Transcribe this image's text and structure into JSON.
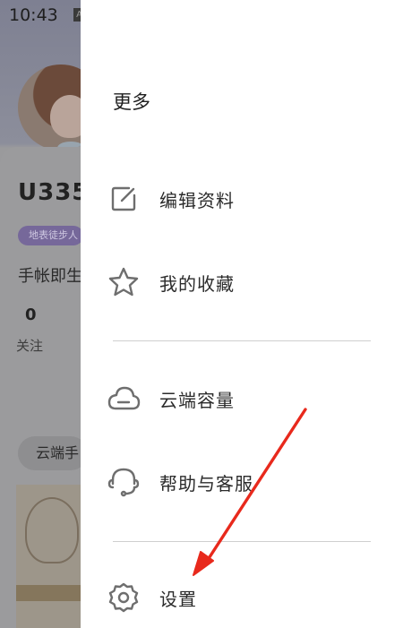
{
  "status_bar": {
    "time": "10:43",
    "notification_glyph": "A",
    "icons": [
      "wifi-icon",
      "cell-signal-icon",
      "battery-charging-icon"
    ]
  },
  "background_profile": {
    "username": "U335",
    "badge": "地表徒步人",
    "bio": "手帐即生",
    "follow_count": "0",
    "follow_label": "关注",
    "tab_label": "云端手"
  },
  "drawer": {
    "title": "更多",
    "items": [
      {
        "label": "编辑资料",
        "icon": "edit-icon"
      },
      {
        "label": "我的收藏",
        "icon": "star-icon"
      },
      {
        "label": "云端容量",
        "icon": "cloud-icon"
      },
      {
        "label": "帮助与客服",
        "icon": "headset-icon"
      },
      {
        "label": "设置",
        "icon": "gear-icon"
      }
    ]
  },
  "annotation": {
    "arrow_color": "#e8291c",
    "points_to": "settings"
  },
  "colors": {
    "drawer_background": "#ffffff",
    "text": "#2b2b2b",
    "icon_stroke": "#6e6e6e",
    "divider": "#cfcfcf",
    "overlay": "#8d8d91"
  }
}
